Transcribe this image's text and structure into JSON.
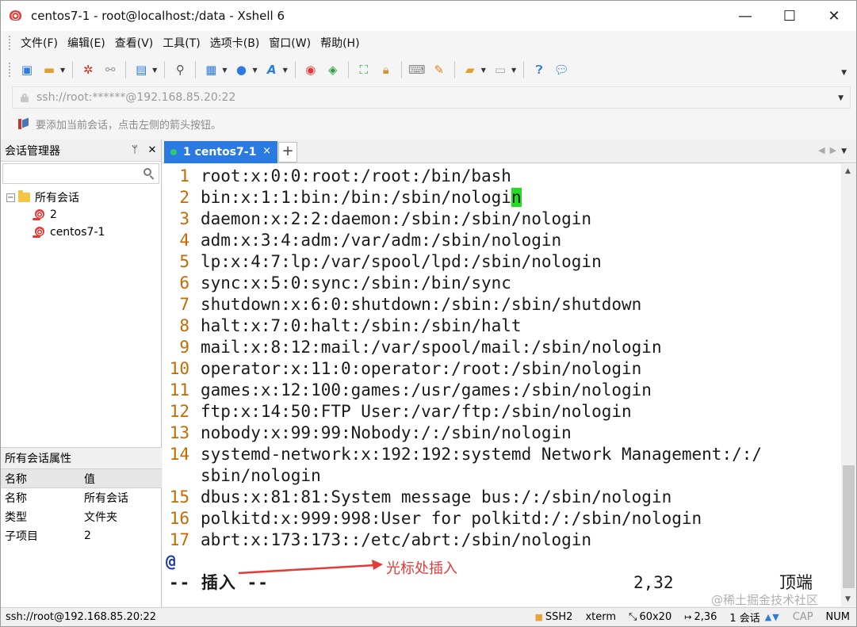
{
  "window": {
    "title": "centos7-1 - root@localhost:/data - Xshell 6",
    "minimize": "—",
    "maximize": "☐",
    "close": "✕"
  },
  "menu": [
    "文件(F)",
    "编辑(E)",
    "查看(V)",
    "工具(T)",
    "选项卡(B)",
    "窗口(W)",
    "帮助(H)"
  ],
  "address": {
    "text": "ssh://root:******@192.168.85.20:22"
  },
  "info": {
    "text": "要添加当前会话，点击左侧的箭头按钮。"
  },
  "session_manager": {
    "title": "会话管理器",
    "pin": "ᛘ",
    "close": "✕",
    "search_placeholder": "",
    "tree": {
      "root_label": "所有会话",
      "root_expander": "−",
      "children": [
        "2",
        "centos7-1"
      ]
    }
  },
  "properties": {
    "title": "所有会话属性",
    "headers": [
      "名称",
      "值"
    ],
    "rows": [
      [
        "名称",
        "所有会话"
      ],
      [
        "类型",
        "文件夹"
      ],
      [
        "子项目",
        "2"
      ]
    ]
  },
  "tab": {
    "label": "1 centos7-1",
    "close": "×",
    "add": "+"
  },
  "terminal": {
    "lines": [
      {
        "num": "1",
        "text": "root:x:0:0:root:/root:/bin/bash"
      },
      {
        "num": "2",
        "text": "bin:x:1:1:bin:/bin:/sbin/nologi",
        "cursor_char": "n"
      },
      {
        "num": "3",
        "text": "daemon:x:2:2:daemon:/sbin:/sbin/nologin"
      },
      {
        "num": "4",
        "text": "adm:x:3:4:adm:/var/adm:/sbin/nologin"
      },
      {
        "num": "5",
        "text": "lp:x:4:7:lp:/var/spool/lpd:/sbin/nologin"
      },
      {
        "num": "6",
        "text": "sync:x:5:0:sync:/sbin:/bin/sync"
      },
      {
        "num": "7",
        "text": "shutdown:x:6:0:shutdown:/sbin:/sbin/shutdown"
      },
      {
        "num": "8",
        "text": "halt:x:7:0:halt:/sbin:/sbin/halt"
      },
      {
        "num": "9",
        "text": "mail:x:8:12:mail:/var/spool/mail:/sbin/nologin"
      },
      {
        "num": "10",
        "text": "operator:x:11:0:operator:/root:/sbin/nologin"
      },
      {
        "num": "11",
        "text": "games:x:12:100:games:/usr/games:/sbin/nologin"
      },
      {
        "num": "12",
        "text": "ftp:x:14:50:FTP User:/var/ftp:/sbin/nologin"
      },
      {
        "num": "13",
        "text": "nobody:x:99:99:Nobody:/:/sbin/nologin"
      },
      {
        "num": "14",
        "text": "systemd-network:x:192:192:systemd Network Management:/:/"
      },
      {
        "num": "",
        "text": "sbin/nologin"
      },
      {
        "num": "15",
        "text": "dbus:x:81:81:System message bus:/:/sbin/nologin"
      },
      {
        "num": "16",
        "text": "polkitd:x:999:998:User for polkitd:/:/sbin/nologin"
      },
      {
        "num": "17",
        "text": "abrt:x:173:173::/etc/abrt:/sbin/nologin"
      }
    ],
    "tilde": "@",
    "mode": "-- 插入 --",
    "position": "2,32",
    "scroll_pos": "顶端",
    "annotation": "光标处插入"
  },
  "status": {
    "connection": "ssh://root@192.168.85.20:22",
    "protocol": "SSH2",
    "term": "xterm",
    "size": "60x20",
    "cursor": "2,36",
    "sessions": "1 会话",
    "cap": "CAP",
    "num": "NUM"
  },
  "watermark": "@稀土掘金技术社区",
  "colors": {
    "tab_active": "#2a7ae2",
    "line_number": "#c56a00",
    "cursor_bg": "#22dd22",
    "annotation": "#e53935"
  }
}
